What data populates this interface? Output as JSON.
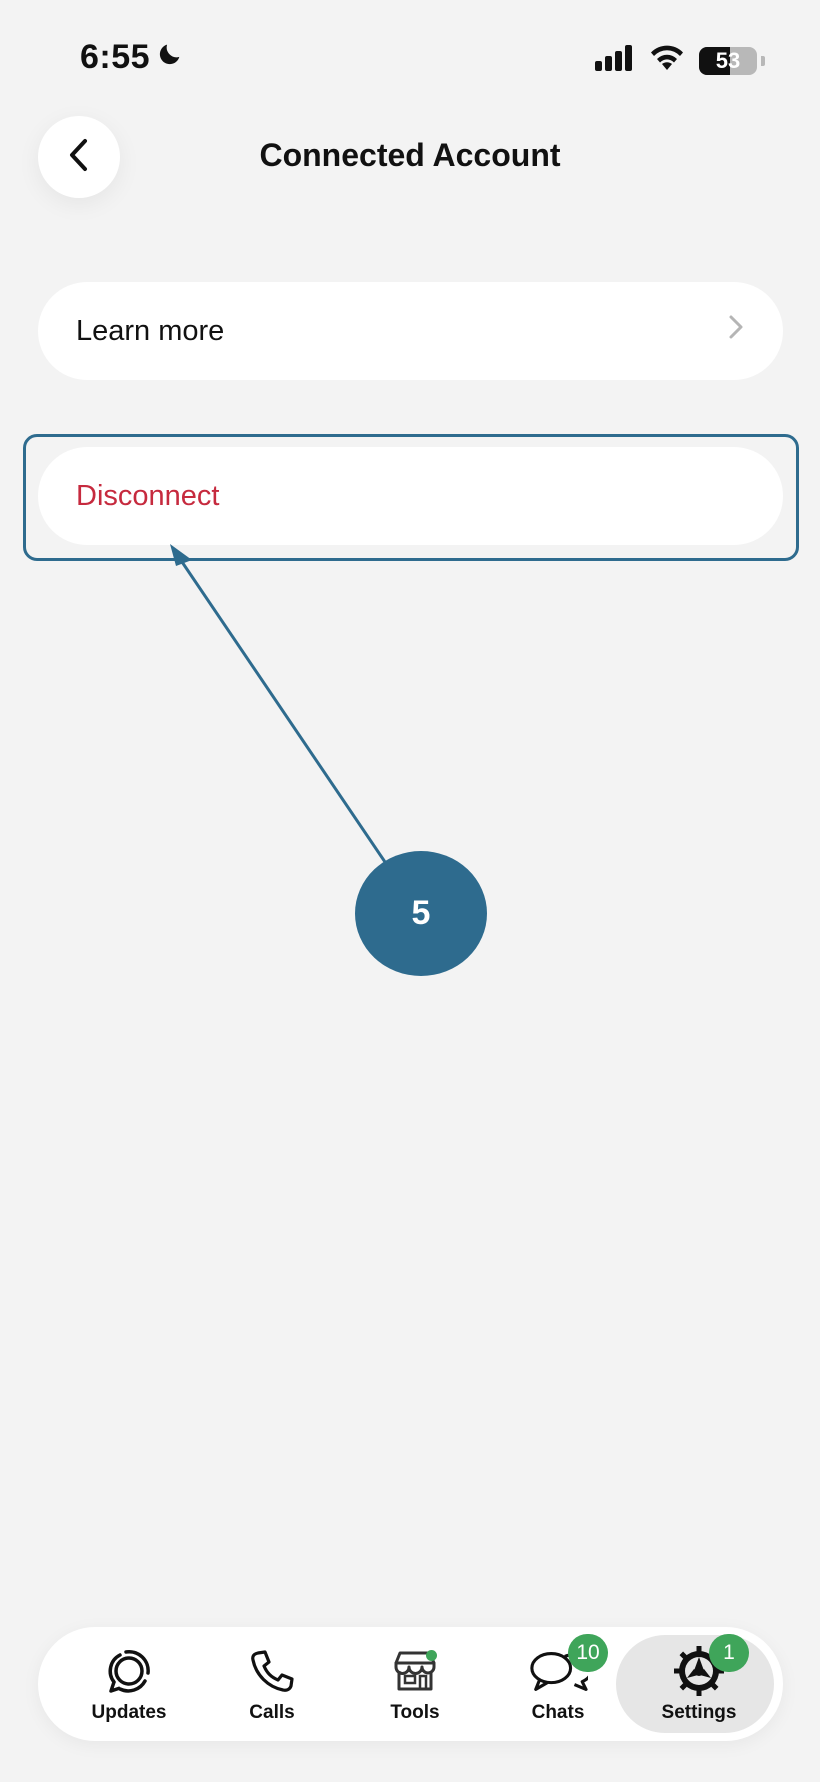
{
  "status_bar": {
    "time": "6:55",
    "battery": "53",
    "battery_level": 0.53
  },
  "header": {
    "title": "Connected Account"
  },
  "rows": {
    "learn_more": "Learn more",
    "disconnect": "Disconnect"
  },
  "annotation": {
    "step": "5",
    "color": "#2e6b8e"
  },
  "tabbar": {
    "tabs": [
      {
        "label": "Updates",
        "icon": "updates-icon"
      },
      {
        "label": "Calls",
        "icon": "phone-icon"
      },
      {
        "label": "Tools",
        "icon": "store-icon"
      },
      {
        "label": "Chats",
        "icon": "chats-icon",
        "badge": "10"
      },
      {
        "label": "Settings",
        "icon": "settings-icon",
        "badge": "1",
        "active": true
      }
    ]
  },
  "colors": {
    "accent_green": "#3fa55a",
    "danger": "#c62a3e",
    "background": "#f3f3f3"
  }
}
